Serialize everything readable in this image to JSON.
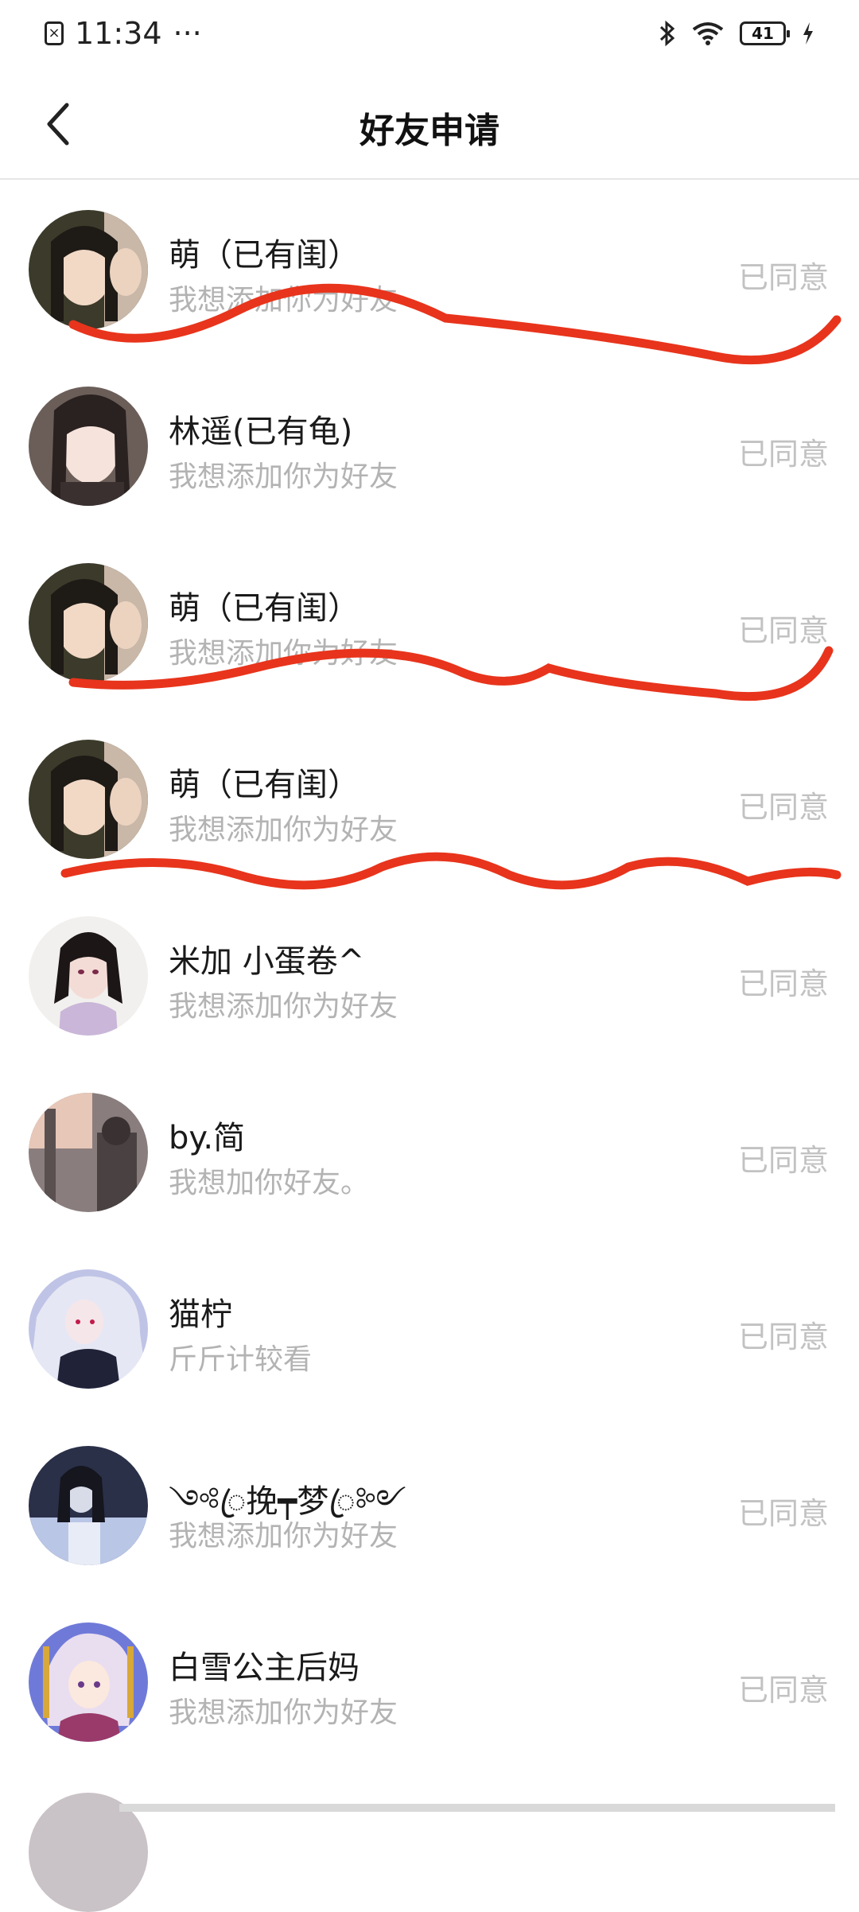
{
  "status_bar": {
    "time": "11:34",
    "dots": "···",
    "battery": "41"
  },
  "nav": {
    "title": "好友申请"
  },
  "items": [
    {
      "name": "萌（已有闺）",
      "message": "我想添加你为好友",
      "status": "已同意"
    },
    {
      "name": "林遥(已有龟)",
      "message": "我想添加你为好友",
      "status": "已同意"
    },
    {
      "name": "萌（已有闺）",
      "message": "我想添加你为好友",
      "status": "已同意"
    },
    {
      "name": "萌（已有闺）",
      "message": "我想添加你为好友",
      "status": "已同意"
    },
    {
      "name": "米加 小蛋卷^",
      "message": "我想添加你为好友",
      "status": "已同意"
    },
    {
      "name": "by.简",
      "message": "我想加你好友。",
      "status": "已同意"
    },
    {
      "name": "猫柠",
      "message": "斤斤计较看",
      "status": "已同意"
    },
    {
      "name": "༺ꦿ挽┯梦ꦿ༻",
      "message": "我想添加你为好友",
      "status": "已同意"
    },
    {
      "name": "白雪公主后妈",
      "message": "我想添加你为好友",
      "status": "已同意"
    }
  ],
  "colors": {
    "annotation": "#e8341c",
    "muted": "#b3b3b3"
  }
}
